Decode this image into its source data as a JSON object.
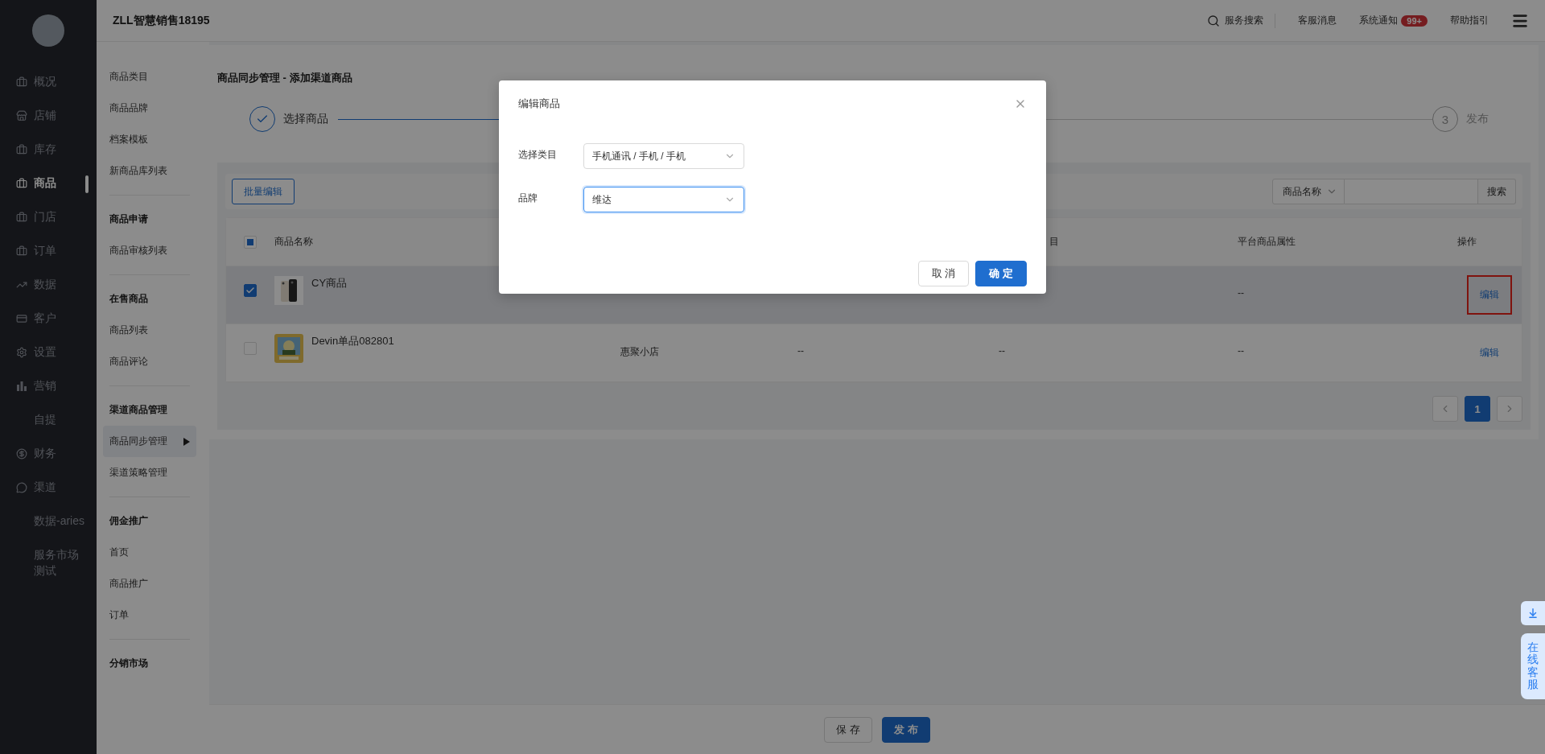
{
  "app": {
    "title": "ZLL智慧销售18195"
  },
  "nav": [
    {
      "label": "概况",
      "kind": "briefcase",
      "selected": false
    },
    {
      "label": "店铺",
      "kind": "store",
      "selected": false
    },
    {
      "label": "库存",
      "kind": "briefcase",
      "selected": false
    },
    {
      "label": "商品",
      "kind": "briefcase",
      "selected": true
    },
    {
      "label": "门店",
      "kind": "briefcase",
      "selected": false
    },
    {
      "label": "订单",
      "kind": "briefcase",
      "selected": false
    },
    {
      "label": "数据",
      "kind": "trend",
      "selected": false
    },
    {
      "label": "客户",
      "kind": "card",
      "selected": false
    },
    {
      "label": "设置",
      "kind": "gear",
      "selected": false
    },
    {
      "label": "营销",
      "kind": "bars",
      "selected": false
    },
    {
      "label": "自提",
      "kind": "none",
      "selected": false
    },
    {
      "label": "财务",
      "kind": "coin",
      "selected": false
    },
    {
      "label": "渠道",
      "kind": "chat",
      "selected": false
    },
    {
      "label": "数据-aries",
      "kind": "none",
      "selected": false
    },
    {
      "label": "服务市场测试",
      "kind": "none",
      "selected": false
    }
  ],
  "header": {
    "search": "服务搜索",
    "messages": "客服消息",
    "notice": "系统通知",
    "notice_badge": "99+",
    "help": "帮助指引"
  },
  "subnav": [
    {
      "items": [
        {
          "label": "商品类目",
          "selected": false
        },
        {
          "label": "商品品牌",
          "selected": false
        },
        {
          "label": "档案模板",
          "selected": false
        },
        {
          "label": "新商品库列表",
          "selected": false
        }
      ]
    },
    {
      "heading": "商品申请",
      "items": [
        {
          "label": "商品审核列表",
          "selected": false
        }
      ]
    },
    {
      "heading": "在售商品",
      "items": [
        {
          "label": "商品列表",
          "selected": false
        },
        {
          "label": "商品评论",
          "selected": false
        }
      ]
    },
    {
      "heading": "渠道商品管理",
      "items": [
        {
          "label": "商品同步管理",
          "selected": true
        },
        {
          "label": "渠道策略管理",
          "selected": false
        }
      ]
    },
    {
      "heading": "佣金推广",
      "items": [
        {
          "label": "首页",
          "selected": false
        },
        {
          "label": "商品推广",
          "selected": false
        },
        {
          "label": "订单",
          "selected": false
        }
      ]
    },
    {
      "heading": "分销市场"
    }
  ],
  "page_title": "商品同步管理 - 添加渠道商品",
  "steps": [
    {
      "label": "选择商品",
      "done": true
    },
    {
      "number": "3",
      "label": "发布",
      "done": false
    }
  ],
  "toolbar": {
    "bulk_button": "批量编辑",
    "search_type": "商品名称",
    "search_button": "搜索"
  },
  "table": {
    "all_indeterminate": true,
    "columns": {
      "name": "商品名称",
      "column_4": "目",
      "column_5": "平台商品属性",
      "actions": "操作"
    },
    "rows": [
      {
        "selected": true,
        "checked": true,
        "name": "CY商品",
        "column_5": "--",
        "action": "编辑",
        "action_outlined": true
      },
      {
        "selected": false,
        "checked": false,
        "name": "Devin单品082801",
        "column_2": "惠聚小店",
        "column_3": "--",
        "column_4": "--",
        "column_5": "--",
        "action": "编辑",
        "action_outlined": false
      }
    ]
  },
  "pagination": [
    {
      "label": "1",
      "selected": true
    }
  ],
  "footer_buttons": [
    {
      "label": "保 存",
      "kind": "default"
    },
    {
      "label": "发 布",
      "kind": "primary"
    }
  ],
  "float_service": "在线客服",
  "modal": {
    "title": "编辑商品",
    "fields": [
      {
        "label": "选择类目",
        "value": "手机通讯 / 手机 / 手机",
        "focused": false
      },
      {
        "label": "品牌",
        "value": "维达",
        "focused": true
      }
    ],
    "buttons": [
      {
        "label": "取 消",
        "kind": "default"
      },
      {
        "label": "确 定",
        "kind": "primary"
      }
    ]
  }
}
